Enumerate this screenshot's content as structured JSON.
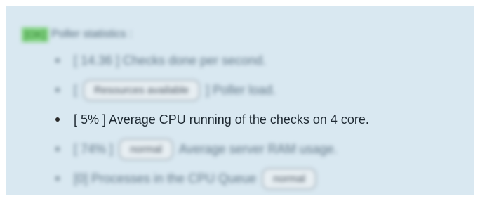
{
  "poller": {
    "tag": "[OK]",
    "title": "Poller statistics :"
  },
  "stats": [
    {
      "id": "checks",
      "prefix": "[ 14.36 ] Checks done per second.",
      "badge": "",
      "suffix": ""
    },
    {
      "id": "load",
      "prefix": "[",
      "badge": "Resources available",
      "suffix": "] Poller load."
    },
    {
      "id": "cpu",
      "prefix": "[ 5% ] Average CPU running of the checks on 4 core.",
      "badge": "",
      "suffix": ""
    },
    {
      "id": "ram",
      "prefix": "[ 74% ]",
      "badge": "normal",
      "suffix": "Average server RAM usage."
    },
    {
      "id": "queue",
      "prefix": "[0] Processes in the CPU Queue",
      "badge": "normal",
      "suffix": ""
    }
  ]
}
